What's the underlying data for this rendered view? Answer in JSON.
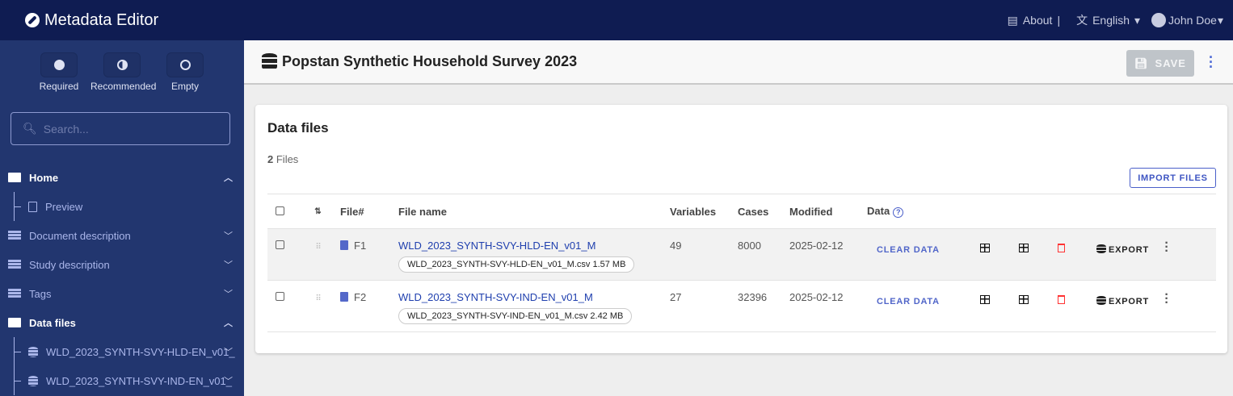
{
  "app": {
    "title": "Metadata Editor",
    "about": "About",
    "language": "English",
    "user": "John Doe",
    "separator": "|"
  },
  "sidebar": {
    "legend": [
      {
        "label": "Required",
        "icon": "check-circle-icon"
      },
      {
        "label": "Recommended",
        "icon": "half-circle-icon"
      },
      {
        "label": "Empty",
        "icon": "empty-circle-icon"
      }
    ],
    "search_placeholder": "Search...",
    "items": [
      {
        "label": "Home",
        "expanded": true
      },
      {
        "label": "Preview"
      },
      {
        "label": "Document description"
      },
      {
        "label": "Study description"
      },
      {
        "label": "Tags"
      },
      {
        "label": "Data files",
        "expanded": true
      },
      {
        "label": "WLD_2023_SYNTH-SVY-HLD-EN_v01_"
      },
      {
        "label": "WLD_2023_SYNTH-SVY-IND-EN_v01_"
      }
    ]
  },
  "project": {
    "title": "Popstan Synthetic Household Survey 2023",
    "save_label": "SAVE"
  },
  "datafiles": {
    "heading": "Data files",
    "count": "2",
    "count_label": "Files",
    "import_label": "IMPORT FILES",
    "columns": {
      "sort": "⇅",
      "file_no": "File#",
      "file_name": "File name",
      "variables": "Variables",
      "cases": "Cases",
      "modified": "Modified",
      "data": "Data"
    },
    "rows": [
      {
        "file_no": "F1",
        "name": "WLD_2023_SYNTH-SVY-HLD-EN_v01_M",
        "chip": "WLD_2023_SYNTH-SVY-HLD-EN_v01_M.csv 1.57 MB",
        "variables": "49",
        "cases": "8000",
        "modified": "2025-02-12",
        "clear": "CLEAR DATA",
        "export": "EXPORT"
      },
      {
        "file_no": "F2",
        "name": "WLD_2023_SYNTH-SVY-IND-EN_v01_M",
        "chip": "WLD_2023_SYNTH-SVY-IND-EN_v01_M.csv 2.42 MB",
        "variables": "27",
        "cases": "32396",
        "modified": "2025-02-12",
        "clear": "CLEAR DATA",
        "export": "EXPORT"
      }
    ]
  },
  "colors": {
    "header": "#0f1c52",
    "sidebar": "#22366f",
    "accent": "#4a5fc9",
    "danger": "#ff3333"
  }
}
